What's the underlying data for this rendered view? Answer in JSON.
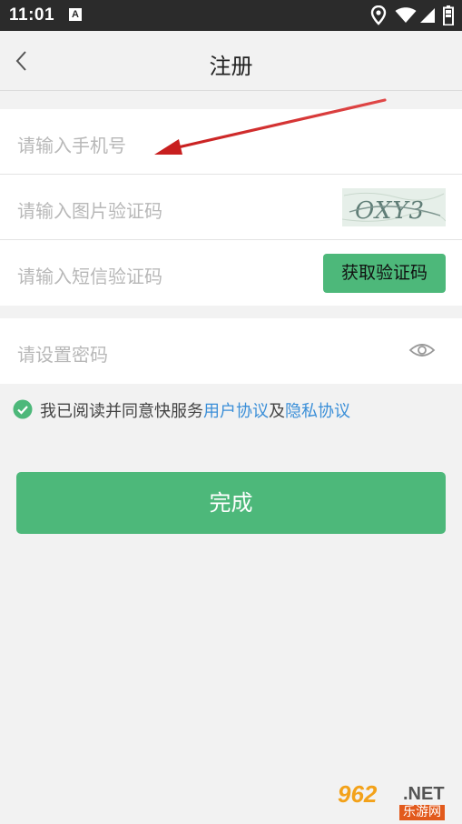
{
  "status_bar": {
    "time": "11:01",
    "notification_letter": "A",
    "icons": [
      "location-icon",
      "wifi-icon",
      "signal-icon",
      "battery-icon"
    ]
  },
  "nav": {
    "title": "注册",
    "back_icon": "chevron-left-icon"
  },
  "form": {
    "phone_placeholder": "请输入手机号",
    "image_code_placeholder": "请输入图片验证码",
    "captcha_text": "OXY3",
    "sms_code_placeholder": "请输入短信验证码",
    "get_code_label": "获取验证码",
    "password_placeholder": "请设置密码"
  },
  "agreement": {
    "prefix": "我已阅读并同意快服务",
    "user_agreement": "用户协议",
    "conjunction": "及",
    "privacy_agreement": "隐私协议",
    "checked": true
  },
  "actions": {
    "done_label": "完成"
  },
  "watermark": {
    "main": "962",
    "suffix": ".NET",
    "sub": "乐游网"
  },
  "colors": {
    "accent_green": "#4db87a",
    "link_blue": "#3b8fd8",
    "annotation_arrow": "#d42a2a",
    "status_bar": "#2b2b2b",
    "background": "#f2f2f2"
  }
}
